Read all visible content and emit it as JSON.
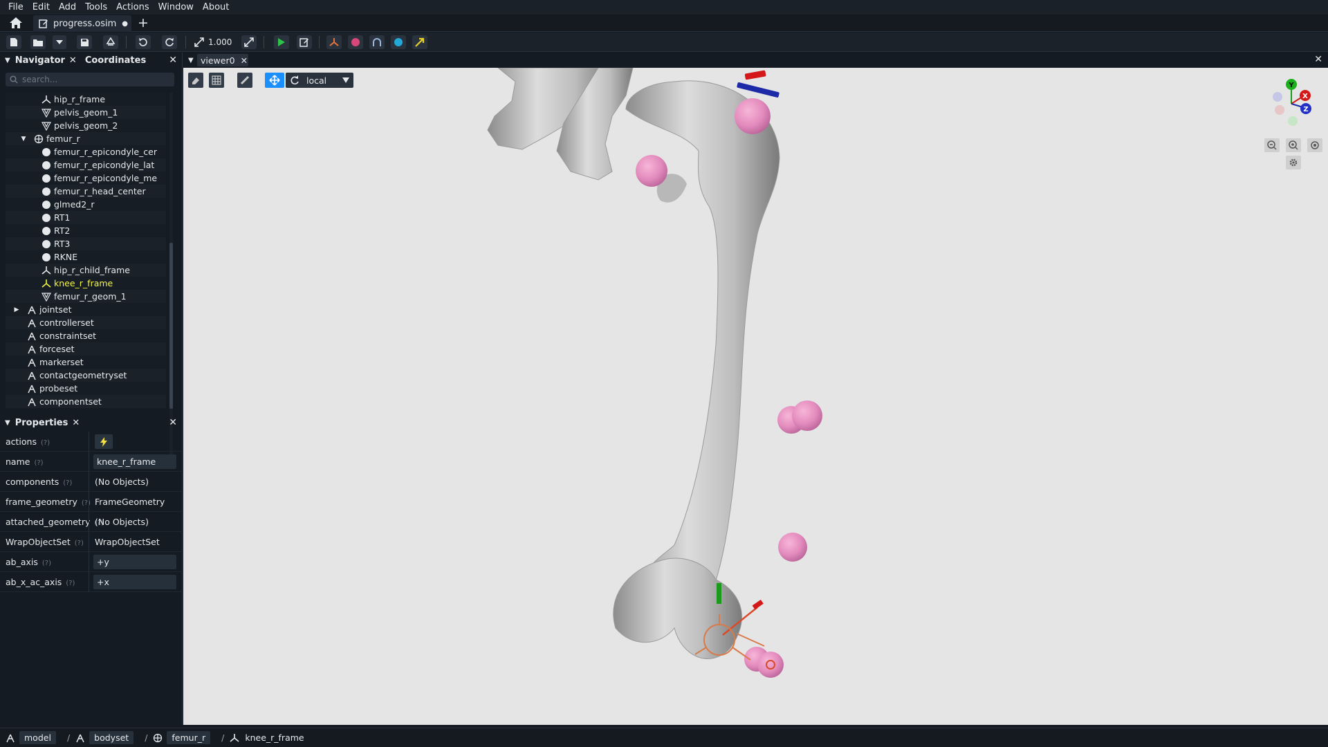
{
  "menu": [
    "File",
    "Edit",
    "Add",
    "Tools",
    "Actions",
    "Window",
    "About"
  ],
  "tab": {
    "filename": "progress.osim",
    "modified": "●",
    "new_tab": "+"
  },
  "toolbar": {
    "zoom_value": "1.000"
  },
  "navigator": {
    "title": "Navigator",
    "second_tab": "Coordinates",
    "search_placeholder": "search...",
    "items": [
      {
        "label": "hip_r_frame",
        "icon": "frame-icon",
        "indent": 2
      },
      {
        "label": "pelvis_geom_1",
        "icon": "geometry-icon",
        "indent": 2
      },
      {
        "label": "pelvis_geom_2",
        "icon": "geometry-icon",
        "indent": 2
      },
      {
        "label": "femur_r",
        "icon": "body-icon",
        "indent": 1,
        "expanded": true
      },
      {
        "label": "femur_r_epicondyle_cer",
        "icon": "marker-icon",
        "indent": 2
      },
      {
        "label": "femur_r_epicondyle_lat",
        "icon": "marker-icon",
        "indent": 2
      },
      {
        "label": "femur_r_epicondyle_me",
        "icon": "marker-icon",
        "indent": 2
      },
      {
        "label": "femur_r_head_center",
        "icon": "marker-icon",
        "indent": 2
      },
      {
        "label": "glmed2_r",
        "icon": "marker-icon",
        "indent": 2
      },
      {
        "label": "RT1",
        "icon": "marker-icon",
        "indent": 2
      },
      {
        "label": "RT2",
        "icon": "marker-icon",
        "indent": 2
      },
      {
        "label": "RT3",
        "icon": "marker-icon",
        "indent": 2
      },
      {
        "label": "RKNE",
        "icon": "marker-icon",
        "indent": 2
      },
      {
        "label": "hip_r_child_frame",
        "icon": "frame-icon",
        "indent": 2
      },
      {
        "label": "knee_r_frame",
        "icon": "frame-icon",
        "indent": 2,
        "selected": true
      },
      {
        "label": "femur_r_geom_1",
        "icon": "geometry-icon",
        "indent": 2
      },
      {
        "label": "jointset",
        "icon": "set-icon",
        "indent": 0,
        "collapsed": true
      },
      {
        "label": "controllerset",
        "icon": "set-icon",
        "indent": 0
      },
      {
        "label": "constraintset",
        "icon": "set-icon",
        "indent": 0
      },
      {
        "label": "forceset",
        "icon": "set-icon",
        "indent": 0
      },
      {
        "label": "markerset",
        "icon": "set-icon",
        "indent": 0
      },
      {
        "label": "contactgeometryset",
        "icon": "set-icon",
        "indent": 0
      },
      {
        "label": "probeset",
        "icon": "set-icon",
        "indent": 0
      },
      {
        "label": "componentset",
        "icon": "set-icon",
        "indent": 0
      }
    ]
  },
  "properties": {
    "title": "Properties",
    "help": "(?)",
    "rows": [
      {
        "key": "actions",
        "type": "action"
      },
      {
        "key": "name",
        "value": "knee_r_frame",
        "type": "input"
      },
      {
        "key": "components",
        "value": "(No Objects)",
        "type": "text"
      },
      {
        "key": "frame_geometry",
        "value": "FrameGeometry",
        "type": "text"
      },
      {
        "key": "attached_geometry",
        "value": "(No Objects)",
        "type": "text"
      },
      {
        "key": "WrapObjectSet",
        "value": "WrapObjectSet",
        "type": "text"
      },
      {
        "key": "ab_axis",
        "value": "+y",
        "type": "input"
      },
      {
        "key": "ab_x_ac_axis",
        "value": "+x",
        "type": "input"
      }
    ]
  },
  "viewer": {
    "tab": "viewer0",
    "space_mode": "local",
    "gizmo_labels": {
      "x": "X",
      "y": "Y",
      "z": "Z"
    }
  },
  "breadcrumb": [
    "model",
    "bodyset",
    "femur_r",
    "knee_r_frame"
  ],
  "colors": {
    "accent": "#1a8fff",
    "selected_text": "#f5f542",
    "marker": "#e88fc2",
    "bone": "#cfcfcf",
    "viewer_bg": "#e5e5e5"
  }
}
